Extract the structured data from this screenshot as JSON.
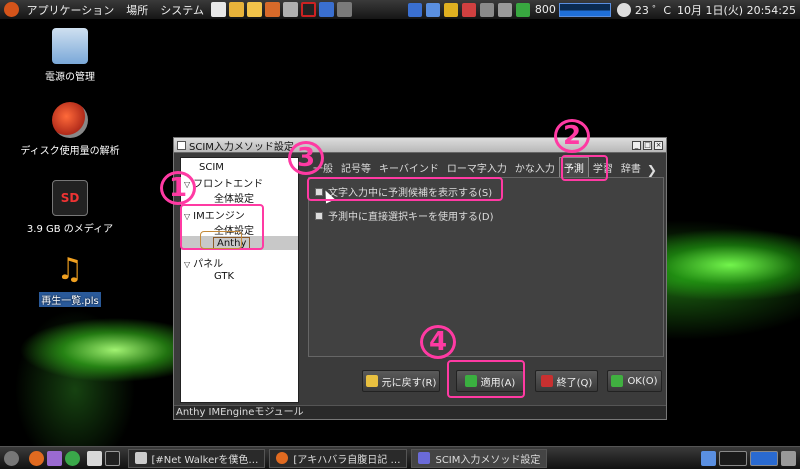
{
  "top_panel": {
    "apps_menu": "アプリケーション",
    "places_menu": "場所",
    "system_menu": "システム",
    "net_speed": "800",
    "temperature": "23 ゜C",
    "clock": "10月 1日(火) 20:54:25"
  },
  "desktop_icons": [
    {
      "label": "電源の管理"
    },
    {
      "label": "ディスク使用量の解析"
    },
    {
      "label": "3.9 GB のメディア",
      "badge": "SD"
    },
    {
      "label": "再生一覧.pls"
    }
  ],
  "window": {
    "title": "SCIM入力メソッド設定",
    "tree": {
      "scim": "SCIM",
      "frontend": "フロントエンド",
      "frontend_global": "全体設定",
      "imengine": "IMエンジン",
      "imengine_global": "全体設定",
      "anthy": "Anthy",
      "panel": "パネル",
      "gtk": "GTK"
    },
    "tabs": [
      "一般",
      "記号等",
      "キーバインド",
      "ローマ字入力",
      "かな入力",
      "予測",
      "学習",
      "辞書"
    ],
    "active_tab": "予測",
    "options": [
      {
        "label": "文字入力中に予測候補を表示する(S)",
        "checked": false
      },
      {
        "label": "予測中に直接選択キーを使用する(D)",
        "checked": false
      }
    ],
    "buttons": {
      "revert": "元に戻す(R)",
      "apply": "適用(A)",
      "quit": "終了(Q)",
      "ok": "OK(O)"
    },
    "status": "Anthy IMEngineモジュール"
  },
  "annotations": [
    "1",
    "2",
    "3",
    "4"
  ],
  "taskbar": [
    {
      "label": "[#Net Walkerを僕色…"
    },
    {
      "label": "[アキハバラ自腹日記 …"
    },
    {
      "label": "SCIM入力メソッド設定"
    }
  ],
  "colors": {
    "annotation": "#ff3aa3",
    "highlight_green": "#5cff3a"
  }
}
